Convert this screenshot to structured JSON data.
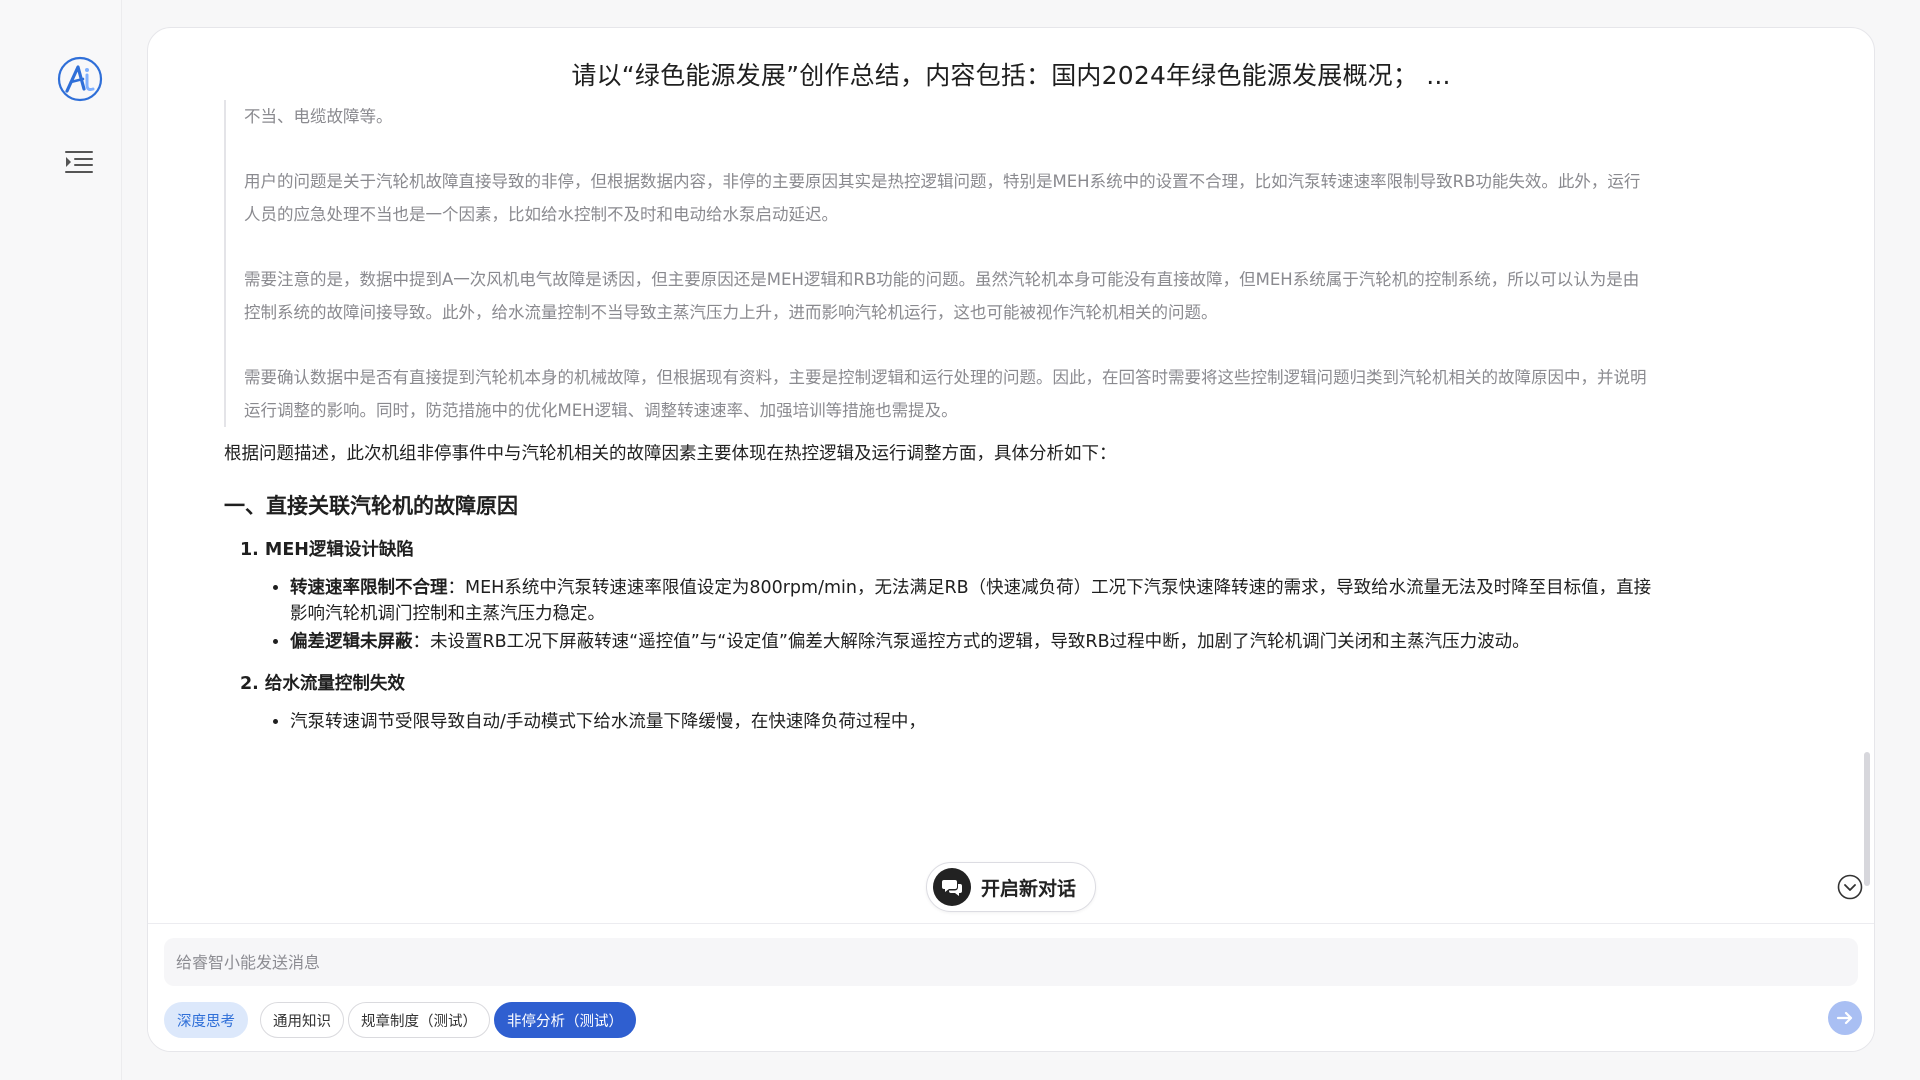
{
  "conversation": {
    "title": "请以“绿色能源发展”创作总结，内容包括：国内2024年绿色能源发展概况；  ..."
  },
  "thinking": {
    "paragraphs": [
      "不当、电缆故障等。",
      "用户的问题是关于汽轮机故障直接导致的非停，但根据数据内容，非停的主要原因其实是热控逻辑问题，特别是MEH系统中的设置不合理，比如汽泵转速速率限制导致RB功能失效。此外，运行人员的应急处理不当也是一个因素，比如给水控制不及时和电动给水泵启动延迟。",
      "需要注意的是，数据中提到A一次风机电气故障是诱因，但主要原因还是MEH逻辑和RB功能的问题。虽然汽轮机本身可能没有直接故障，但MEH系统属于汽轮机的控制系统，所以可以认为是由控制系统的故障间接导致。此外，给水流量控制不当导致主蒸汽压力上升，进而影响汽轮机运行，这也可能被视作汽轮机相关的问题。",
      "需要确认数据中是否有直接提到汽轮机本身的机械故障，但根据现有资料，主要是控制逻辑和运行处理的问题。因此，在回答时需要将这些控制逻辑问题归类到汽轮机相关的故障原因中，并说明运行调整的影响。同时，防范措施中的优化MEH逻辑、调整转速速率、加强培训等措施也需提及。"
    ]
  },
  "answer": {
    "lead": "根据问题描述，此次机组非停事件中与汽轮机相关的故障因素主要体现在热控逻辑及运行调整方面，具体分析如下：",
    "section_title": "一、直接关联汽轮机的故障原因",
    "item1_title": "1. MEH逻辑设计缺陷",
    "item1_b1_bold": "转速速率限制不合理",
    "item1_b1_text": "：MEH系统中汽泵转速速率限值设定为800rpm/min，无法满足RB（快速减负荷）工况下汽泵快速降转速的需求，导致给水流量无法及时降至目标值，直接影响汽轮机调门控制和主蒸汽压力稳定。",
    "item1_b2_bold": "偏差逻辑未屏蔽",
    "item1_b2_text": "：未设置RB工况下屏蔽转速“遥控值”与“设定值”偏差大解除汽泵遥控方式的逻辑，导致RB过程中断，加剧了汽轮机调门关闭和主蒸汽压力波动。",
    "item2_title": "2. 给水流量控制失效",
    "item2_b1_text": "汽泵转速调节受限导致自动/手动模式下给水流量下降缓慢，在快速降负荷过程中，"
  },
  "new_chat": {
    "label": "开启新对话"
  },
  "composer": {
    "placeholder": "给睿智小能发送消息",
    "value": ""
  },
  "chips": {
    "deep_think": "深度思考",
    "general": "通用知识",
    "rules": "规章制度（测试）",
    "outage": "非停分析（测试）"
  },
  "colors": {
    "accent": "#2f5fd0",
    "deep_think_bg": "#dce8fb",
    "send_bg": "#a9bff3"
  },
  "icons": {
    "logo": "app-logo-icon",
    "menu": "menu-list-icon",
    "new_chat": "chat-bubbles-icon",
    "scroll": "chevron-down-circle-icon",
    "send": "arrow-right-icon"
  }
}
